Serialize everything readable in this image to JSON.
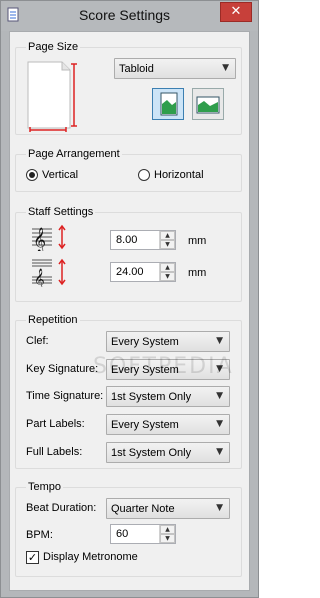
{
  "window": {
    "title": "Score Settings",
    "close_glyph": "✕"
  },
  "page_size": {
    "title": "Page Size",
    "selected": "Tabloid",
    "portrait_icon": "portrait-page-icon",
    "landscape_icon": "landscape-page-icon"
  },
  "page_arrangement": {
    "title": "Page Arrangement",
    "vertical_label": "Vertical",
    "horizontal_label": "Horizontal",
    "selected": "Vertical"
  },
  "staff_settings": {
    "title": "Staff Settings",
    "staff_spacing": "8.00",
    "system_spacing": "24.00",
    "unit": "mm"
  },
  "repetition": {
    "title": "Repetition",
    "rows": [
      {
        "label": "Clef:",
        "value": "Every System"
      },
      {
        "label": "Key Signature:",
        "value": "Every System"
      },
      {
        "label": "Time Signature:",
        "value": "1st System Only"
      },
      {
        "label": "Part Labels:",
        "value": "Every System"
      },
      {
        "label": "Full Labels:",
        "value": "1st System Only"
      }
    ]
  },
  "tempo": {
    "title": "Tempo",
    "beat_label": "Beat Duration:",
    "beat_value": "Quarter Note",
    "bpm_label": "BPM:",
    "bpm_value": "60",
    "metronome_label": "Display Metronome",
    "metronome_checked": true
  },
  "watermark": "SOFTPEDIA"
}
